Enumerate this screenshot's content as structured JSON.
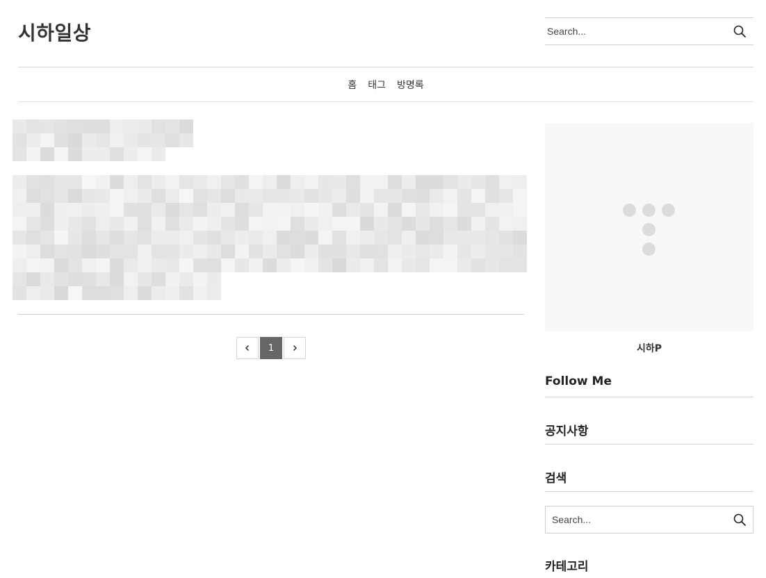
{
  "header": {
    "site_title": "시하일상",
    "search_placeholder": "Search..."
  },
  "nav": {
    "items": [
      "홈",
      "태그",
      "방명록"
    ]
  },
  "pagination": {
    "prev": "‹",
    "current": "1",
    "next": "›"
  },
  "sidebar": {
    "profile_name": "시하P",
    "widgets": {
      "follow": "Follow Me",
      "notice": "공지사항",
      "search": "검색",
      "category": "카테고리"
    },
    "search_placeholder": "Search..."
  },
  "colors": {
    "divider": "#d6d6d6",
    "active_page": "#666666",
    "profile_bg": "#f8f8f8"
  },
  "icons": [
    "search-icon",
    "chevron-left-icon",
    "chevron-right-icon",
    "profile-placeholder-icon"
  ]
}
